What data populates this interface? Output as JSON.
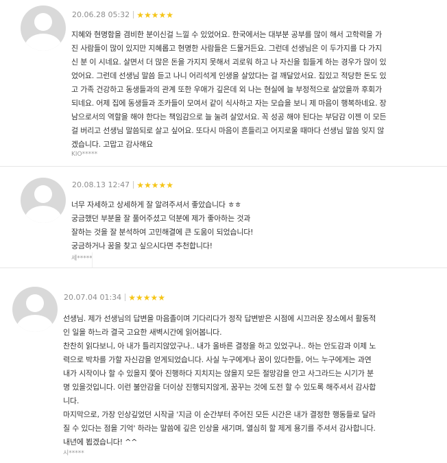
{
  "reviews": [
    {
      "date": "20.06.28 05:32",
      "stars": 5,
      "lines": [
        "지혜와 현명함을 겸비한 분이신걸 느낄 수 있었어요. 한국에서는 대부분 공부를 많이 해서 고학력을 가",
        "진 사람들이 많이 있지만 지혜롭고 현명한 사람들은 드물거든요. 그런데 선생님은 이 두가지를 다 가지",
        "신 분 이 시네요. 살면서 더 많은 돈을 가지지 못해서 괴로워 하고 나 자신을 힘들게 하는 경우가 많이 있",
        "었어요. 그런데 선생님 말씀 듣고 나니 어리석게 인생을 살았다는 걸 깨달았서요. 집있고 적당한 돈도 있",
        "고 가족 건강하고 동생들과의 관계 또한 우애가 깊은데 외 나는 현실에 늘 부정적으로 살았을까 후회가",
        "되네요. 어제 집에 동생들과 조카들이 모여서 같이 식사하고 자는 모습을 보니 제 마음이 행복하네요. 장",
        "남으로서의 역할을 해야 한다는 책임감으로 늘 눌려 살았서요. 꼭 성공 해야 된다는 부담감 이젠 이 모든",
        "걸 버리고 선생님 말씀되로 살고 싶어요. 또다시 마음이 흔들리고 어지로울 때마다 선생님 말씀 잊지 않",
        "겠습니다. 고맙고 감사해요"
      ],
      "author": "KIO*****"
    },
    {
      "date": "20.08.13 12:47",
      "stars": 5,
      "lines": [
        "너무 자세하고 상세하게 잘 알려주셔서 좋았습니다 ㅎㅎ",
        "궁금했던 부분을 잘 풀어주셨고 덕분에 제가 좋아하는 것과",
        "잘하는 것을 잘 분석하여 고민해결에 큰 도움이 되었습니다!",
        "궁금하거나 꿈을 찾고 싶으시다면 추천합니다!"
      ],
      "author": "세*****"
    },
    {
      "date": "20.07.04 01:34",
      "stars": 5,
      "lines": [
        "선생님. 제가 선생님의 답변을 마음졸이며 기다리다가 정작 답변받은 시점에 시끄러운 장소에서 활동적",
        "인 일을 하느라 결국 고요한 새벽시간에 읽어봅니다.",
        "찬찬히 읽다보니, 아 내가 틀리지않았구나.. 내가 올바른 결정을 하고 있었구나.. 하는 안도감과 이제 노",
        "력으로 박차를 가할 자신감을 얻게되었습니다. 사실 누구에게나 꿈이 있다한들, 어느 누구에게는 과연",
        "내가 시작이나 할 수 있을지 쫓아 진행하다 지치지는 않을지 모든 절망감을 안고 사그라드는 시기가 분",
        "명 있을것입니다. 이런 불안감을 더이상 진행되지않게, 꿈꾸는 것에 도전 할 수 있도록 해주셔서 감사합",
        "니다.",
        "마지막으로, 가장 인상깊었던 시작글 '지금 이 순간부터 주어진 모든 시간은 내가 결정한 행동들로 달라",
        "질 수 있다는 점을 기억' 하라는 말씀에 깊은 인상을 새기며, 열심히 할 제게 용기를 주셔서 감사합니다.",
        "내년에 뵙겠습니다! ^^"
      ],
      "author": "시*****"
    }
  ],
  "icons": {
    "star": "★",
    "avatar": "default-user-avatar-icon"
  },
  "colors": {
    "star": "#f5c518",
    "avatar_bg": "#d9d9d9",
    "meta_text": "#8c8c8c"
  }
}
